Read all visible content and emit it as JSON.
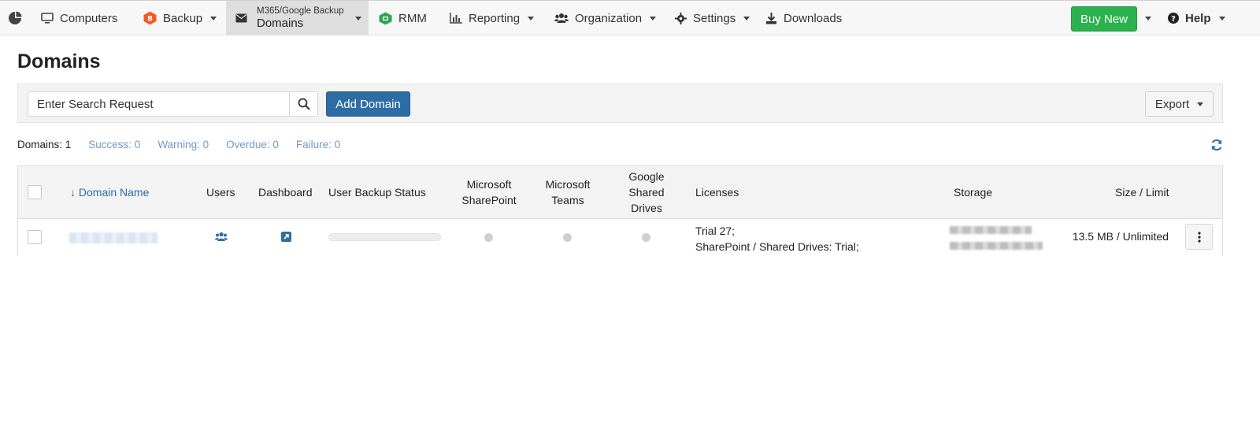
{
  "nav": {
    "computers": "Computers",
    "backup": "Backup",
    "m365_small": "M365/Google Backup",
    "m365_big": "Domains",
    "rmm": "RMM",
    "reporting": "Reporting",
    "organization": "Organization",
    "settings": "Settings",
    "downloads": "Downloads",
    "buy_new": "Buy New",
    "help": "Help"
  },
  "page": {
    "title": "Domains"
  },
  "toolbar": {
    "search_placeholder": "Enter Search Request",
    "add_domain": "Add Domain",
    "export": "Export"
  },
  "counters": {
    "total": "Domains: 1",
    "success": "Success: 0",
    "warning": "Warning: 0",
    "overdue": "Overdue: 0",
    "failure": "Failure: 0"
  },
  "table": {
    "headers": {
      "domain_name": "↓ Domain Name",
      "users": "Users",
      "dashboard": "Dashboard",
      "user_backup_status": "User Backup Status",
      "sharepoint_1": "Microsoft",
      "sharepoint_2": "SharePoint",
      "teams_1": "Microsoft",
      "teams_2": "Teams",
      "drives_1": "Google",
      "drives_2": "Shared",
      "drives_3": "Drives",
      "licenses": "Licenses",
      "storage": "Storage",
      "size_limit": "Size / Limit"
    },
    "rows": [
      {
        "licenses_line1": "Trial 27;",
        "licenses_line2": "SharePoint / Shared Drives: Trial;",
        "size_limit": "13.5 MB / Unlimited"
      }
    ]
  },
  "colors": {
    "brand_blue": "#2e6da4",
    "buy_green": "#2bb24c",
    "link_blue": "#6f9cc3"
  }
}
